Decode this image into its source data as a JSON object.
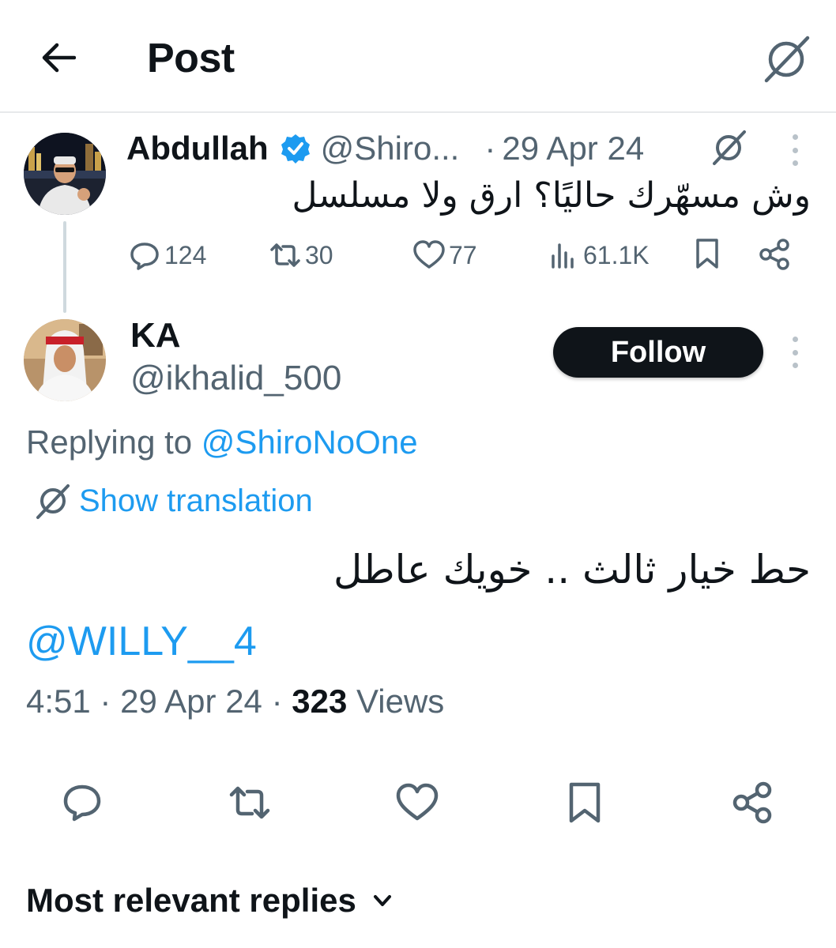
{
  "header": {
    "title": "Post"
  },
  "parent_tweet": {
    "author_name": "Abdullah",
    "author_handle": "@Shiro...",
    "separator": "·",
    "date": "29 Apr 24",
    "text": "وش مسهّرك حاليًا؟ ارق ولا مسلسل",
    "metrics": {
      "replies": "124",
      "retweets": "30",
      "likes": "77",
      "views": "61.1K"
    }
  },
  "reply_tweet": {
    "author_name": "KA",
    "author_handle": "@ikhalid_500",
    "follow_label": "Follow",
    "replying_prefix": "Replying to",
    "replying_to": "@ShiroNoOne",
    "show_translation": "Show translation",
    "text": "حط خيار ثالث .. خويك عاطل",
    "mention": "@WILLY__4",
    "time": "4:51",
    "sep1": "·",
    "date": "29 Apr 24",
    "sep2": "·",
    "views_count": "323",
    "views_label": "Views"
  },
  "replies_section": {
    "sort_label": "Most relevant replies"
  },
  "colors": {
    "accent": "#1d9bf0",
    "text_primary": "#0f1419",
    "text_secondary": "#536471",
    "divider": "#e7e9eb"
  },
  "icons": {
    "back": "arrow-left-icon",
    "translate": "translate-icon",
    "verified": "verified-badge-icon",
    "more": "more-vertical-icon",
    "reply": "reply-icon",
    "retweet": "retweet-icon",
    "like": "heart-icon",
    "views": "views-bar-icon",
    "bookmark": "bookmark-icon",
    "share": "share-icon",
    "chevron": "chevron-down-icon"
  }
}
